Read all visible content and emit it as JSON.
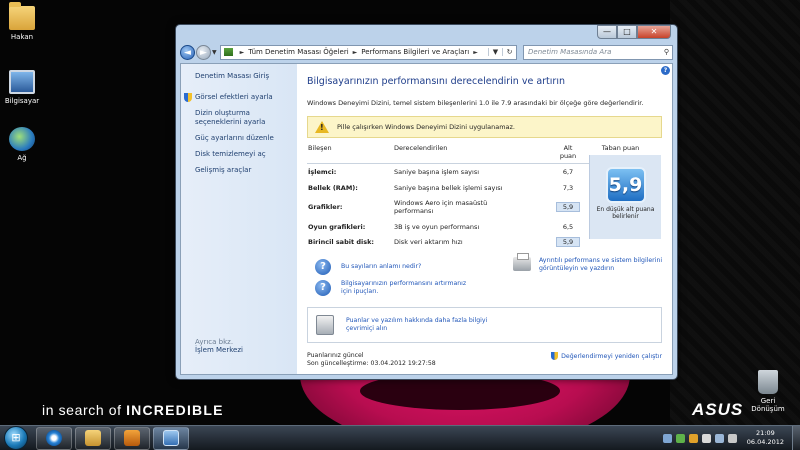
{
  "desktop": {
    "icons": [
      {
        "label": "Hakan",
        "icon": "user-folder-icon"
      },
      {
        "label": "Bilgisayar",
        "icon": "computer-icon"
      },
      {
        "label": "Ağ",
        "icon": "network-icon"
      },
      {
        "label": "Geri Dönüşüm",
        "icon": "recycle-bin-icon"
      }
    ],
    "slogan_prefix": "in search of",
    "slogan_strong": "INCREDIBLE",
    "brand": "ASUS"
  },
  "window": {
    "controls": {
      "minimize": "—",
      "maximize": "□",
      "close": "✕"
    },
    "address": {
      "crumbs": [
        "Tüm Denetim Masası Öğeleri",
        "Performans Bilgileri ve Araçları"
      ],
      "refresh": "↻"
    },
    "search": {
      "placeholder": "Denetim Masasında Ara",
      "icon": "search-icon"
    },
    "left_pane": {
      "home": "Denetim Masası Giriş",
      "items": [
        "Görsel efektleri ayarla",
        "Dizin oluşturma seçeneklerini ayarla",
        "Güç ayarlarını düzenle",
        "Disk temizlemeyi aç",
        "Gelişmiş araçlar"
      ],
      "see_also": "Ayrıca bkz.",
      "action_center": "İşlem Merkezi"
    },
    "main": {
      "title": "Bilgisayarınızın performansını derecelendirin ve artırın",
      "description": "Windows Deneyimi Dizini, temel sistem bileşenlerini 1.0 ile 7.9 arasındaki bir ölçeğe göre değerlendirir.",
      "warning": "Pille çalışırken Windows Deneyimi Dizini uygulanamaz.",
      "table": {
        "headers": {
          "component": "Bileşen",
          "rated": "Derecelendirilen",
          "subscore": "Alt puan",
          "basescore": "Taban puan"
        },
        "rows": [
          {
            "component": "İşlemci:",
            "rated": "Saniye başına işlem sayısı",
            "subscore": "6,7"
          },
          {
            "component": "Bellek (RAM):",
            "rated": "Saniye başına bellek işlemi sayısı",
            "subscore": "7,3"
          },
          {
            "component": "Grafikler:",
            "rated": "Windows Aero için masaüstü performansı",
            "subscore": "5,9"
          },
          {
            "component": "Oyun grafikleri:",
            "rated": "3B iş ve oyun performansı",
            "subscore": "6,5"
          },
          {
            "component": "Birincil sabit disk:",
            "rated": "Disk veri aktarım hızı",
            "subscore": "5,9"
          }
        ],
        "base_score": "5,9",
        "base_caption": "En düşük alt puana belirlenir"
      },
      "links": {
        "scores_meaning": "Bu sayıların anlamı nedir?",
        "improve": "Bilgisayarınızın performansını artırmanız için ipuçları.",
        "details": "Ayrıntılı performans ve sistem bilgilerini görüntüleyin ve yazdırın",
        "online": "Puanlar ve yazılım hakkında daha fazla bilgiyi çevrimiçi alın"
      },
      "footer": {
        "status": "Puanlarınız güncel",
        "last_update": "Son güncelleştirme: 03.04.2012 19:27:58",
        "rerun": "Değerlendirmeyi yeniden çalıştır"
      }
    }
  },
  "taskbar": {
    "start": "⊞",
    "apps": [
      {
        "name": "Internet Explorer",
        "icon": "ie-icon"
      },
      {
        "name": "Windows Gezgini",
        "icon": "explorer-icon"
      },
      {
        "name": "Windows Media Player",
        "icon": "media-player-icon"
      },
      {
        "name": "Denetim Masası",
        "icon": "control-panel-icon"
      }
    ],
    "time": "21:09",
    "date": "06.04.2012"
  }
}
